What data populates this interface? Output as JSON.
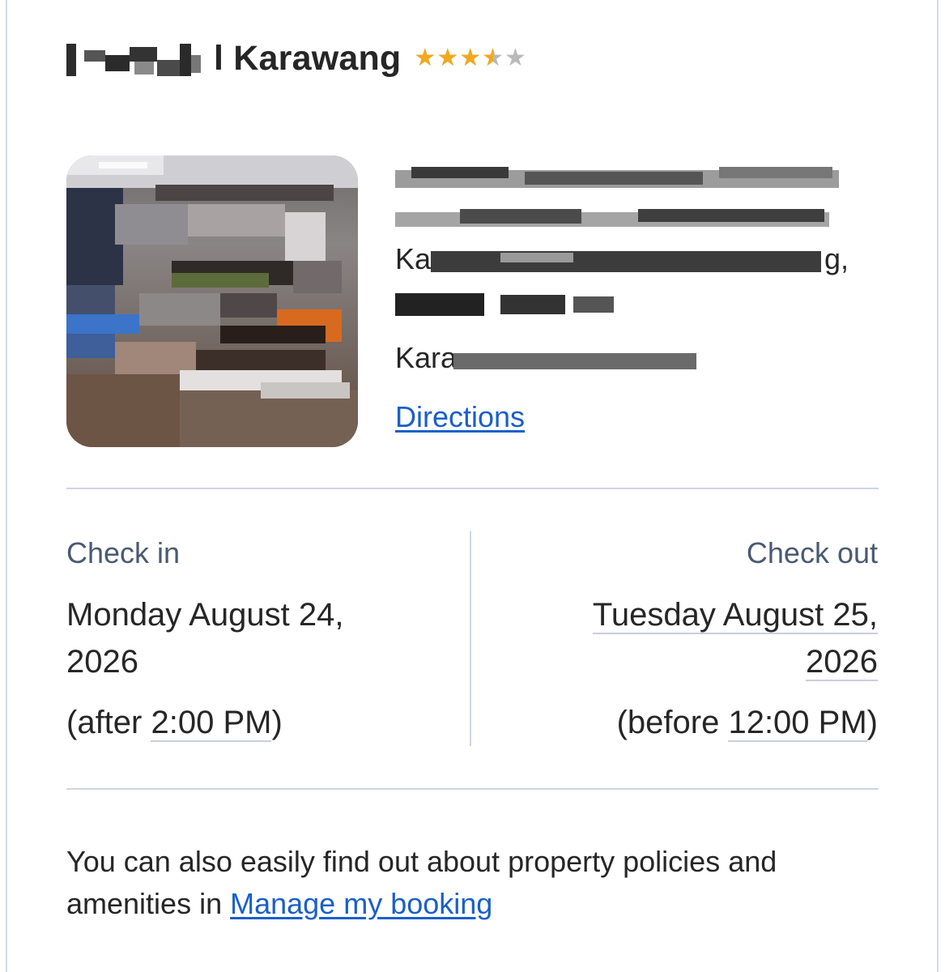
{
  "hotel": {
    "name_suffix": "l Karawang",
    "star_rating": 3.5,
    "star_max": 5,
    "star_glyph": "★",
    "colors": {
      "star_filled": "#f1a91d",
      "star_empty": "#b9b9b9",
      "link": "#1a5fc9"
    }
  },
  "address": {
    "line3_start": "Ka",
    "line3_end": "g,",
    "line5_start": "Kara",
    "directions_label": "Directions"
  },
  "check_in": {
    "label": "Check in",
    "date_line1": "Monday August 24,",
    "date_line2": "2026",
    "time_prefix": "(after ",
    "time": "2:00 PM",
    "time_suffix": ")"
  },
  "check_out": {
    "label": "Check out",
    "date_line1": "Tuesday August 25,",
    "date_line2": "2026",
    "time_prefix": "(before ",
    "time": "12:00 PM",
    "time_suffix": ")"
  },
  "footer": {
    "text": "You can also easily find out about property policies and amenities in ",
    "link_label": "Manage my booking"
  }
}
